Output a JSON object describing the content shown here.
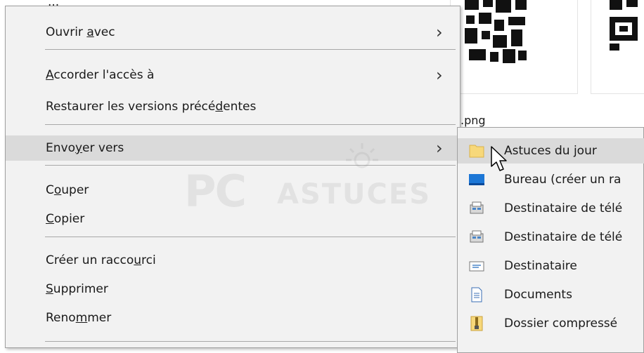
{
  "explorer": {
    "filename_suffix": ".png"
  },
  "context_menu": {
    "partial_top_label": "...",
    "items": [
      {
        "label_parts": [
          "Ouvrir ",
          "a",
          "vec"
        ],
        "submenu": true
      },
      {
        "label_parts": [
          "",
          "A",
          "ccorder l'accès à"
        ],
        "submenu": true
      },
      {
        "label_parts": [
          "Restaurer les versions précé",
          "d",
          "entes"
        ],
        "submenu": false
      },
      {
        "label_parts": [
          "Envo",
          "y",
          "er vers"
        ],
        "submenu": true,
        "highlighted": true
      },
      {
        "label_parts": [
          "C",
          "o",
          "uper"
        ],
        "submenu": false
      },
      {
        "label_parts": [
          "",
          "C",
          "opier"
        ],
        "submenu": false
      },
      {
        "label_parts": [
          "Créer un racco",
          "u",
          "rci"
        ],
        "submenu": false
      },
      {
        "label_parts": [
          "",
          "S",
          "upprimer"
        ],
        "submenu": false
      },
      {
        "label_parts": [
          "Reno",
          "m",
          "mer"
        ],
        "submenu": false
      }
    ],
    "chevron": "›"
  },
  "watermark": {
    "pc": "PC",
    "astuces": "ASTUCES"
  },
  "send_to_submenu": {
    "items": [
      {
        "label": "Astuces du jour",
        "icon": "folder-icon",
        "highlighted": true
      },
      {
        "label": "Bureau (créer un ra",
        "icon": "desktop-icon"
      },
      {
        "label": "Destinataire de télé",
        "icon": "fax-icon"
      },
      {
        "label": "Destinataire de télé",
        "icon": "fax-icon"
      },
      {
        "label": "Destinataire",
        "icon": "mail-recipient-icon"
      },
      {
        "label": "Documents",
        "icon": "documents-icon"
      },
      {
        "label": "Dossier compressé",
        "icon": "zip-folder-icon"
      }
    ]
  },
  "colors": {
    "menu_bg": "#f2f2f2",
    "highlight": "#dadada",
    "folder": "#f7d87a",
    "desktop": "#1d77d6"
  }
}
